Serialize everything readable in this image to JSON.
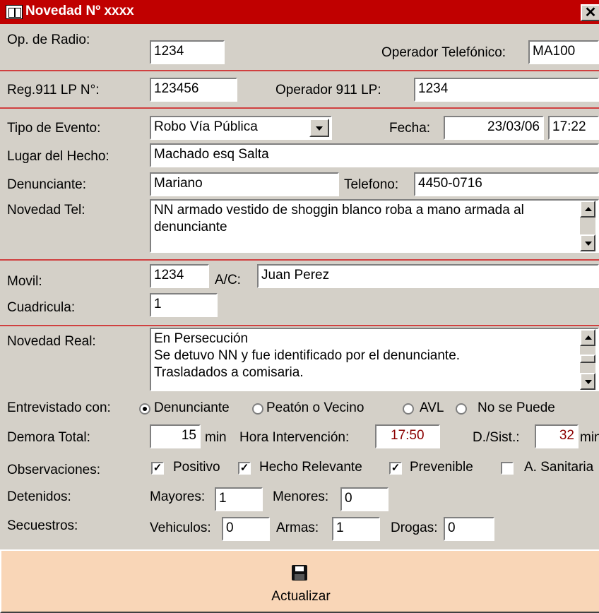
{
  "window": {
    "title": "Novedad Nº xxxx",
    "close_label": "✕"
  },
  "radio": {
    "label": "Op. de Radio:",
    "value": "1234"
  },
  "telefonico": {
    "label": "Operador Telefónico:",
    "value": "MA100"
  },
  "reg911": {
    "label": "Reg.911 LP N°:",
    "value": "123456"
  },
  "op911": {
    "label": "Operador 911 LP:",
    "value": "1234"
  },
  "tipo_evento": {
    "label": "Tipo de Evento:",
    "value": "Robo Vía Pública"
  },
  "fecha": {
    "label": "Fecha:",
    "date": "23/03/06",
    "time": "17:22"
  },
  "lugar": {
    "label": "Lugar del Hecho:",
    "value": "Machado esq Salta"
  },
  "denunciante": {
    "label": "Denunciante:",
    "value": "Mariano"
  },
  "telefono": {
    "label": "Telefono:",
    "value": "4450-0716"
  },
  "novedad_tel": {
    "label": "Novedad Tel:",
    "value": "NN armado vestido de shoggin blanco roba a mano armada al denunciante"
  },
  "movil": {
    "label": "Movil:",
    "value": "1234"
  },
  "ac": {
    "label": "A/C:",
    "value": "Juan Perez"
  },
  "cuadricula": {
    "label": "Cuadricula:",
    "value": "1"
  },
  "novedad_real": {
    "label": "Novedad Real:",
    "lines": [
      "En Persecución",
      "Se detuvo NN y fue identificado por el denunciante.",
      "Trasladados a comisaria."
    ]
  },
  "entrevistado": {
    "label": "Entrevistado con:",
    "options": [
      {
        "label": "Denunciante",
        "selected": true
      },
      {
        "label": "Peatón o Vecino",
        "selected": false
      },
      {
        "label": "AVL",
        "selected": false
      },
      {
        "label": "No se Puede",
        "selected": false
      }
    ]
  },
  "demora": {
    "label": "Demora Total:",
    "value": "15",
    "unit": "min"
  },
  "hora_intervencion": {
    "label": "Hora Intervención:",
    "value": "17:50"
  },
  "dsist": {
    "label": "D./Sist.:",
    "value": "32",
    "unit": "min"
  },
  "observaciones": {
    "label": "Observaciones:",
    "options": [
      {
        "label": "Positivo",
        "checked": true
      },
      {
        "label": "Hecho Relevante",
        "checked": true
      },
      {
        "label": "Prevenible",
        "checked": true
      },
      {
        "label": "A. Sanitaria",
        "checked": false
      }
    ]
  },
  "detenidos": {
    "label": "Detenidos:",
    "mayores_label": "Mayores:",
    "mayores": "1",
    "menores_label": "Menores:",
    "menores": "0"
  },
  "secuestros": {
    "label": "Secuestros:",
    "vehiculos_label": "Vehiculos:",
    "vehiculos": "0",
    "armas_label": "Armas:",
    "armas": "1",
    "drogas_label": "Drogas:",
    "drogas": "0"
  },
  "actualizar": {
    "label": "Actualizar",
    "icon": "floppy-disk-icon"
  },
  "colors": {
    "title_bar": "#c00000",
    "separator": "#d04040",
    "save_button": "#f9d6b7",
    "time_text": "#8b0000"
  }
}
